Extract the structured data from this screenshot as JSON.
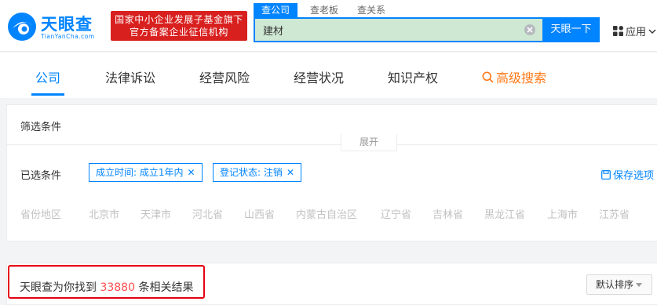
{
  "header": {
    "logo_text": "天眼查",
    "logo_sub": "TianYanCha.com",
    "gov_badge_line1": "国家中小企业发展子基金旗下",
    "gov_badge_line2": "官方备案企业征信机构",
    "search_tabs": [
      "查公司",
      "查老板",
      "查关系"
    ],
    "search_value": "建材",
    "search_button": "天眼一下",
    "apps_label": "应用"
  },
  "nav": {
    "items": [
      "公司",
      "法律诉讼",
      "经营风险",
      "经营状况",
      "知识产权"
    ],
    "advanced": "高级搜索"
  },
  "filter": {
    "title": "筛选条件",
    "chosen_label": "已选条件",
    "chips": [
      "成立时间: 成立1年内",
      "登记状态: 注销"
    ],
    "chip_close": "✕",
    "save_label": "保存选项",
    "region_label": "省份地区",
    "regions": [
      "北京市",
      "天津市",
      "河北省",
      "山西省",
      "内蒙古自治区",
      "辽宁省",
      "吉林省",
      "黑龙江省",
      "上海市",
      "江苏省"
    ],
    "expand": "展开"
  },
  "result": {
    "prefix": "天眼查为你找到",
    "count": "33880",
    "suffix": "条相关结果",
    "sort_label": "默认排序"
  },
  "colors": {
    "accent": "#0084ff",
    "badge_red": "#d8201f",
    "advanced_orange": "#ff7a1a",
    "count_red": "#ff4d4f",
    "highlight_frame": "#e60012"
  }
}
